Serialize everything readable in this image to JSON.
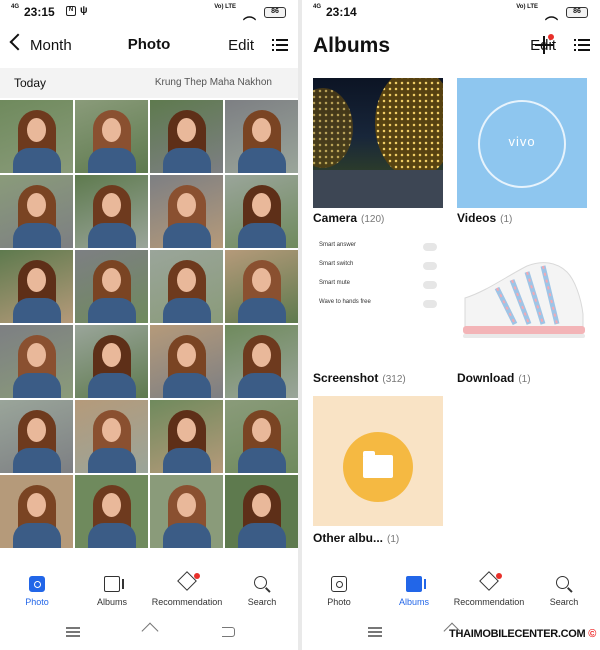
{
  "left": {
    "status": {
      "signal": "4G",
      "time": "23:15",
      "volte": "Vo) LTE",
      "battery": "86"
    },
    "header": {
      "back_label": "Month",
      "title": "Photo",
      "edit": "Edit"
    },
    "date_strip": {
      "left": "Today",
      "right": "Krung Thep Maha Nakhon"
    },
    "nav": [
      {
        "label": "Photo",
        "icon": "photo-icon",
        "active": true
      },
      {
        "label": "Albums",
        "icon": "albums-icon"
      },
      {
        "label": "Recommendation",
        "icon": "recommendation-icon"
      },
      {
        "label": "Search",
        "icon": "search-icon"
      }
    ]
  },
  "right": {
    "status": {
      "signal": "4G",
      "time": "23:14",
      "volte": "Vo) LTE",
      "battery": "86"
    },
    "header": {
      "title": "Albums",
      "edit": "Edit"
    },
    "albums": [
      {
        "name": "Camera",
        "count": "(120)"
      },
      {
        "name": "Videos",
        "count": "(1)"
      },
      {
        "name": "Screenshot",
        "count": "(312)"
      },
      {
        "name": "Download",
        "count": "(1)"
      },
      {
        "name": "Other albu...",
        "count": "(1)"
      }
    ],
    "screenshot_rows": [
      "Smart answer",
      "Smart switch",
      "Smart mute",
      "Wave to hands free"
    ],
    "vivo_text": "vivo",
    "nav": [
      {
        "label": "Photo",
        "icon": "photo-icon"
      },
      {
        "label": "Albums",
        "icon": "albums-icon",
        "active": true
      },
      {
        "label": "Recommendation",
        "icon": "recommendation-icon"
      },
      {
        "label": "Search",
        "icon": "search-icon"
      }
    ]
  },
  "colors": {
    "accent": "#2266e8",
    "badge": "#e8302a",
    "vivo": "#8ec6ef",
    "other_album": "#f9e3c5",
    "folder": "#f5b942"
  },
  "watermark": {
    "text": "THAIMOBILECENTER.COM",
    "symbol": "©"
  }
}
